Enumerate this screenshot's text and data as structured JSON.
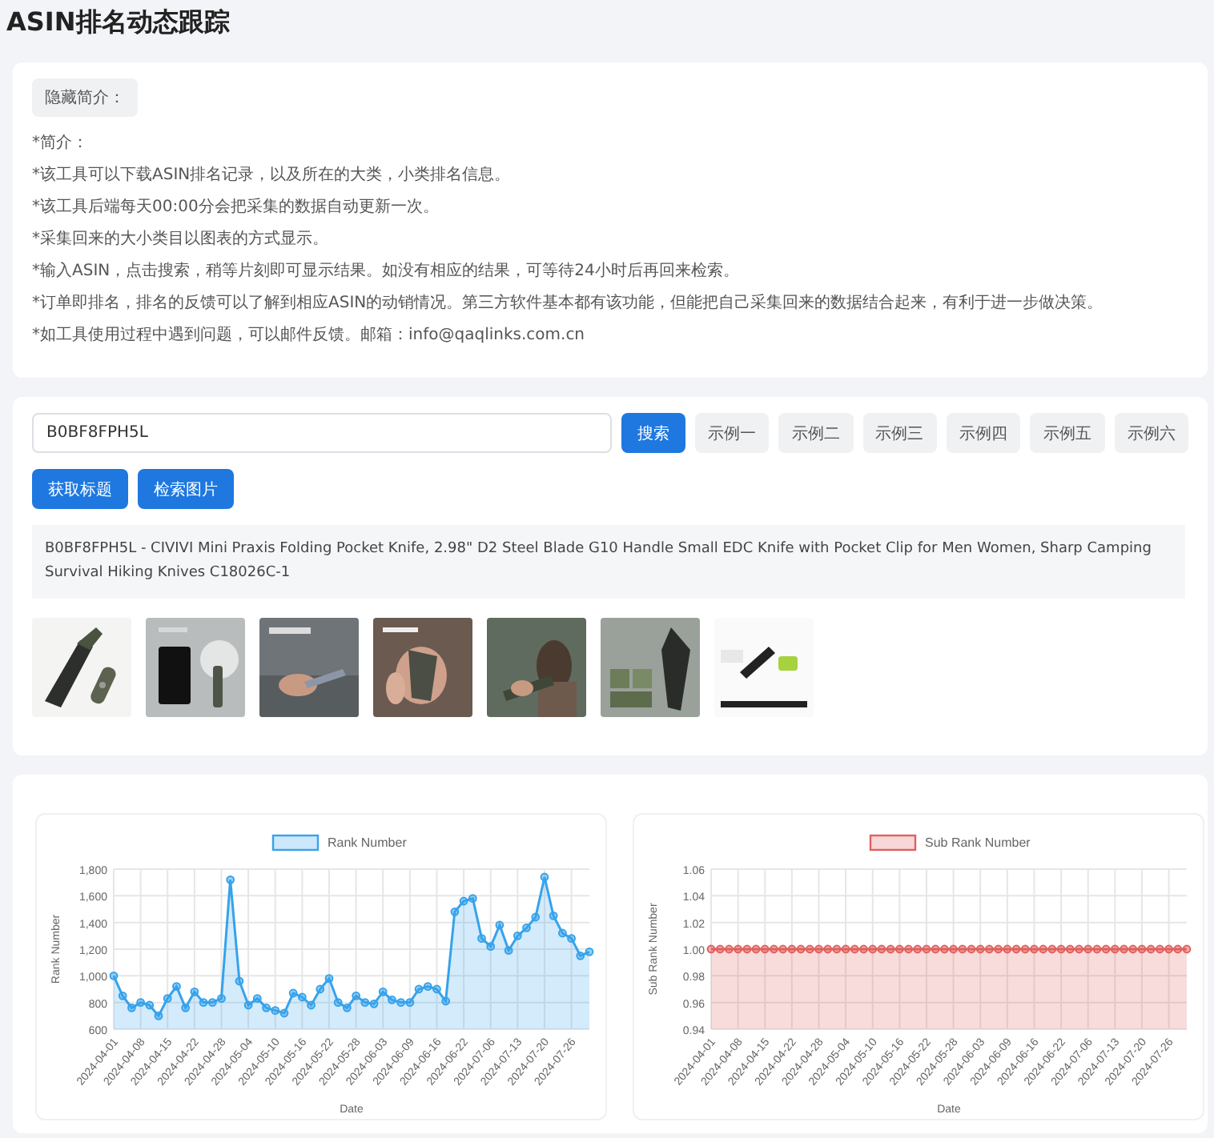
{
  "page_title": "ASIN排名动态跟踪",
  "intro": {
    "toggle_button": "隐藏简介：",
    "lines": [
      "*简介：",
      "*该工具可以下载ASIN排名记录，以及所在的大类，小类排名信息。",
      "*该工具后端每天00:00分会把采集的数据自动更新一次。",
      "*采集回来的大小类目以图表的方式显示。",
      "*输入ASIN，点击搜索，稍等片刻即可显示结果。如没有相应的结果，可等待24小时后再回来检索。",
      "*订单即排名，排名的反馈可以了解到相应ASIN的动销情况。第三方软件基本都有该功能，但能把自己采集回来的数据结合起来，有利于进一步做决策。",
      "*如工具使用过程中遇到问题，可以邮件反馈。邮箱：info@qaqlinks.com.cn"
    ]
  },
  "search": {
    "value": "B0BF8FPH5L",
    "search_button": "搜索",
    "examples": [
      "示例一",
      "示例二",
      "示例三",
      "示例四",
      "示例五",
      "示例六"
    ],
    "actions": [
      "获取标题",
      "检索图片"
    ],
    "product_title": "B0BF8FPH5L - CIVIVI Mini Praxis Folding Pocket Knife, 2.98\" D2 Steel Blade G10 Handle Small EDC Knife with Pocket Clip for Men Women, Sharp Camping Survival Hiking Knives C18026C-1",
    "thumbnails": [
      {
        "kind": "picture"
      },
      {
        "kind": "picture"
      },
      {
        "kind": "picture"
      },
      {
        "kind": "picture"
      },
      {
        "kind": "picture"
      },
      {
        "kind": "picture"
      },
      {
        "kind": "picture"
      }
    ]
  },
  "charts": [
    {
      "chart_data": {
        "type": "area",
        "xlabel": "Date",
        "ylabel": "Rank Number",
        "grid": true,
        "categories": [
          "2024-04-01",
          null,
          null,
          "2024-04-08",
          null,
          null,
          "2024-04-15",
          null,
          null,
          "2024-04-22",
          null,
          null,
          "2024-04-28",
          null,
          null,
          "2024-05-04",
          null,
          null,
          "2024-05-10",
          null,
          null,
          "2024-05-16",
          null,
          null,
          "2024-05-22",
          null,
          null,
          "2024-05-28",
          null,
          null,
          "2024-06-03",
          null,
          null,
          "2024-06-09",
          null,
          null,
          "2024-06-16",
          null,
          null,
          "2024-06-22",
          null,
          null,
          "2024-07-06",
          null,
          null,
          "2024-07-13",
          null,
          null,
          "2024-07-20",
          null,
          null,
          "2024-07-26",
          null,
          null
        ],
        "series": [
          {
            "name": "Rank Number",
            "color": "#36a2eb",
            "values": [
              1000,
              850,
              760,
              800,
              780,
              700,
              830,
              920,
              760,
              880,
              800,
              800,
              830,
              1720,
              960,
              780,
              830,
              760,
              740,
              720,
              870,
              840,
              780,
              900,
              980,
              800,
              760,
              850,
              800,
              790,
              880,
              820,
              800,
              800,
              900,
              920,
              900,
              810,
              1480,
              1560,
              1580,
              1280,
              1220,
              1380,
              1190,
              1300,
              1360,
              1440,
              1740,
              1450,
              1320,
              1280,
              1150,
              1180
            ]
          }
        ],
        "ylim": [
          600,
          1800
        ],
        "yticks": [
          {
            "value": 600,
            "label": "600"
          },
          {
            "value": 800,
            "label": "800"
          },
          {
            "value": 1000,
            "label": "1,000"
          },
          {
            "value": 1200,
            "label": "1,200"
          },
          {
            "value": 1400,
            "label": "1,400"
          },
          {
            "value": 1600,
            "label": "1,600"
          },
          {
            "value": 1800,
            "label": "1,800"
          }
        ]
      }
    },
    {
      "chart_data": {
        "type": "area",
        "xlabel": "Date",
        "ylabel": "Sub Rank Number",
        "grid": true,
        "categories": [
          "2024-04-01",
          null,
          null,
          "2024-04-08",
          null,
          null,
          "2024-04-15",
          null,
          null,
          "2024-04-22",
          null,
          null,
          "2024-04-28",
          null,
          null,
          "2024-05-04",
          null,
          null,
          "2024-05-10",
          null,
          null,
          "2024-05-16",
          null,
          null,
          "2024-05-22",
          null,
          null,
          "2024-05-28",
          null,
          null,
          "2024-06-03",
          null,
          null,
          "2024-06-09",
          null,
          null,
          "2024-06-16",
          null,
          null,
          "2024-06-22",
          null,
          null,
          "2024-07-06",
          null,
          null,
          "2024-07-13",
          null,
          null,
          "2024-07-20",
          null,
          null,
          "2024-07-26",
          null,
          null
        ],
        "series": [
          {
            "name": "Sub Rank Number",
            "color": "#e0605e",
            "values": [
              1,
              1,
              1,
              1,
              1,
              1,
              1,
              1,
              1,
              1,
              1,
              1,
              1,
              1,
              1,
              1,
              1,
              1,
              1,
              1,
              1,
              1,
              1,
              1,
              1,
              1,
              1,
              1,
              1,
              1,
              1,
              1,
              1,
              1,
              1,
              1,
              1,
              1,
              1,
              1,
              1,
              1,
              1,
              1,
              1,
              1,
              1,
              1,
              1,
              1,
              1,
              1,
              1,
              1
            ]
          }
        ],
        "ylim": [
          0.94,
          1.06
        ],
        "yticks": [
          {
            "value": 0.94,
            "label": "0.94"
          },
          {
            "value": 0.96,
            "label": "0.96"
          },
          {
            "value": 0.98,
            "label": "0.98"
          },
          {
            "value": 1.0,
            "label": "1.00"
          },
          {
            "value": 1.02,
            "label": "1.02"
          },
          {
            "value": 1.04,
            "label": "1.04"
          },
          {
            "value": 1.06,
            "label": "1.06"
          }
        ]
      }
    }
  ]
}
